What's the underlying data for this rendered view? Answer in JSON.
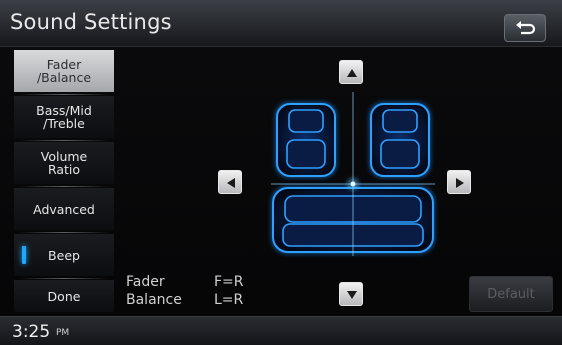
{
  "header": {
    "title": "Sound Settings",
    "back_icon": "back-arrow-icon"
  },
  "sidebar": {
    "items": [
      {
        "label_line1": "Fader",
        "label_line2": "/Balance",
        "active": true
      },
      {
        "label_line1": "Bass/Mid",
        "label_line2": "/Treble",
        "active": false
      },
      {
        "label_line1": "Volume",
        "label_line2": "Ratio",
        "active": false
      },
      {
        "label_line1": "Advanced",
        "label_line2": "",
        "active": false
      },
      {
        "label_line1": "Beep",
        "label_line2": "",
        "active": false,
        "indicator_color": "#19a9ff"
      },
      {
        "label_line1": "Done",
        "label_line2": "",
        "active": false
      }
    ]
  },
  "controls": {
    "up_icon": "triangle-up-icon",
    "down_icon": "triangle-down-icon",
    "left_icon": "triangle-left-icon",
    "right_icon": "triangle-right-icon"
  },
  "readout": {
    "fader_label": "Fader",
    "fader_value": "F=R",
    "balance_label": "Balance",
    "balance_value": "L=R"
  },
  "default_button": {
    "label": "Default",
    "enabled": false
  },
  "status_bar": {
    "time": "3:25",
    "ampm": "PM"
  },
  "colors": {
    "accent": "#19a9ff",
    "seat_glow": "#1b8fff"
  }
}
